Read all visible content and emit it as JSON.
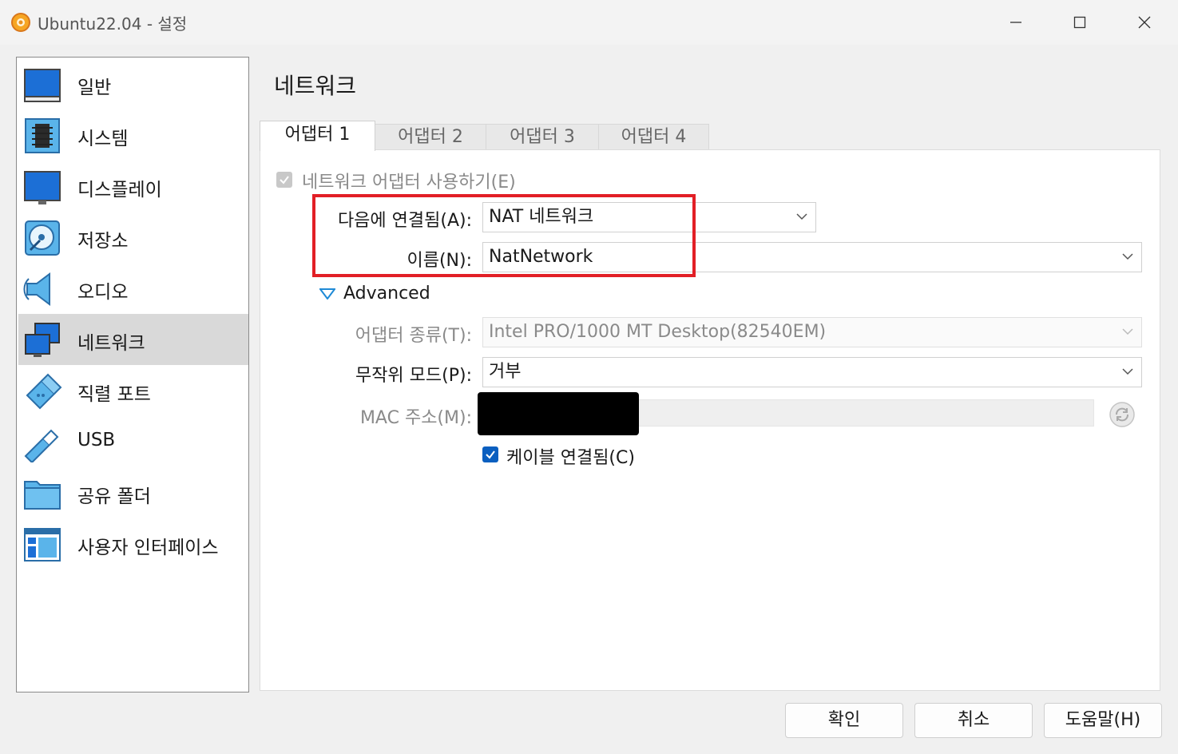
{
  "window": {
    "title": "Ubuntu22.04 - 설정"
  },
  "sidebar": {
    "items": [
      {
        "label": "일반",
        "icon": "general-icon"
      },
      {
        "label": "시스템",
        "icon": "system-icon"
      },
      {
        "label": "디스플레이",
        "icon": "display-icon"
      },
      {
        "label": "저장소",
        "icon": "storage-icon"
      },
      {
        "label": "오디오",
        "icon": "audio-icon"
      },
      {
        "label": "네트워크",
        "icon": "network-icon"
      },
      {
        "label": "직렬 포트",
        "icon": "serial-port-icon"
      },
      {
        "label": "USB",
        "icon": "usb-icon"
      },
      {
        "label": "공유 폴더",
        "icon": "shared-folder-icon"
      },
      {
        "label": "사용자 인터페이스",
        "icon": "user-interface-icon"
      }
    ],
    "selected_index": 5
  },
  "page": {
    "title": "네트워크"
  },
  "tabs": [
    "어댑터 1",
    "어댑터 2",
    "어댑터 3",
    "어댑터 4"
  ],
  "adapter": {
    "enable_label": "네트워크 어댑터 사용하기(E)",
    "enable_checked": true,
    "attached_label": "다음에 연결됨(A):",
    "attached_value": "NAT 네트워크",
    "name_label": "이름(N):",
    "name_value": "NatNetwork",
    "advanced_label": "Advanced",
    "type_label": "어댑터 종류(T):",
    "type_value": "Intel PRO/1000 MT Desktop(82540EM)",
    "promisc_label": "무작위 모드(P):",
    "promisc_value": "거부",
    "mac_label": "MAC 주소(M):",
    "cable_label": "케이블 연결됨(C)",
    "cable_checked": true
  },
  "buttons": {
    "ok": "확인",
    "cancel": "취소",
    "help": "도움말(H)"
  },
  "colors": {
    "highlight": "#e21f26",
    "checkbox_on": "#0a5fc0",
    "selected_bg": "#d9d9d9"
  }
}
